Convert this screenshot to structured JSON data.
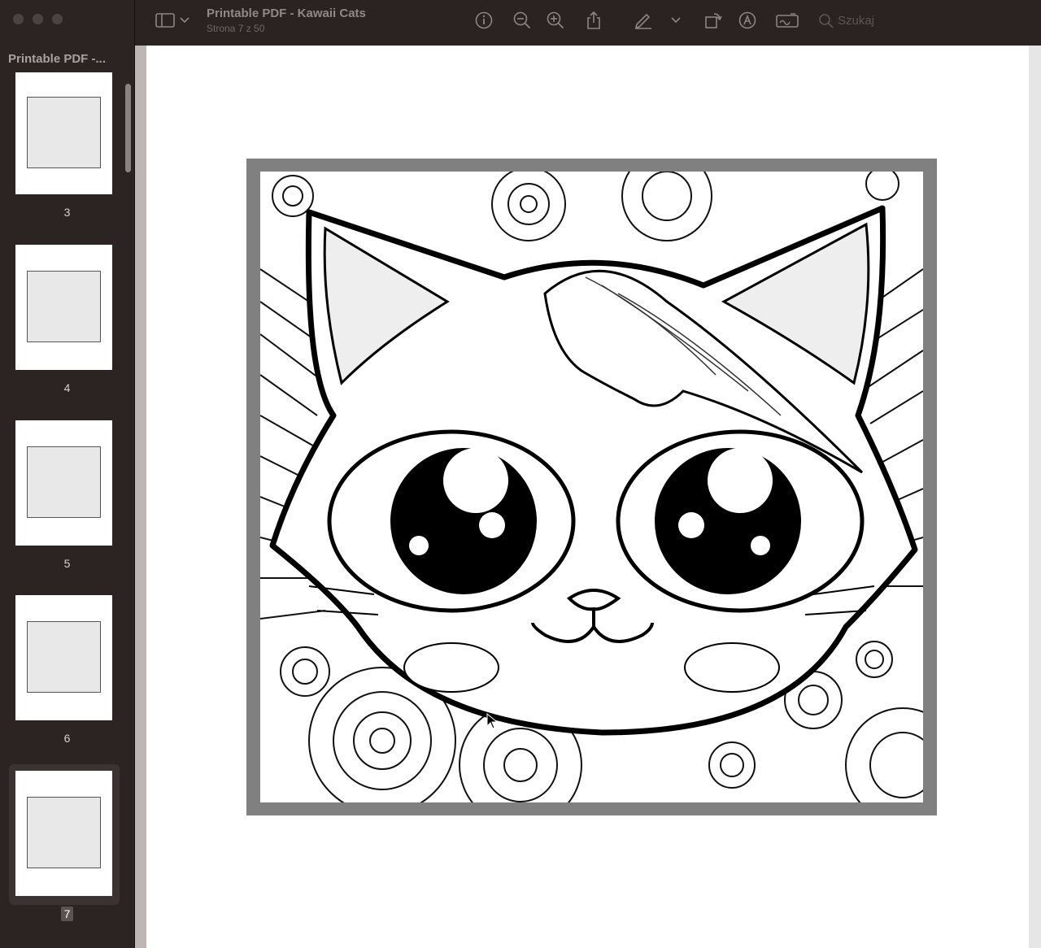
{
  "window": {
    "doc_title": "Printable PDF - Kawaii Cats",
    "page_status": "Strona 7 z 50"
  },
  "sidebar": {
    "title": "Printable PDF -...",
    "thumbnails": [
      {
        "label": "3",
        "selected": false
      },
      {
        "label": "4",
        "selected": false
      },
      {
        "label": "5",
        "selected": false
      },
      {
        "label": "6",
        "selected": false
      },
      {
        "label": "7",
        "selected": true
      }
    ]
  },
  "toolbar": {
    "search_placeholder": "Szukaj",
    "icons": [
      "sidebar-toggle-icon",
      "chevron-down-icon",
      "info-icon",
      "zoom-out-icon",
      "zoom-in-icon",
      "share-icon",
      "markup-pen-icon",
      "chevron-down-icon",
      "rotate-icon",
      "annotate-icon",
      "signature-icon",
      "search-icon"
    ]
  },
  "colors": {
    "chrome": "#2a2322",
    "page": "#ffffff",
    "frame": "#808080"
  }
}
